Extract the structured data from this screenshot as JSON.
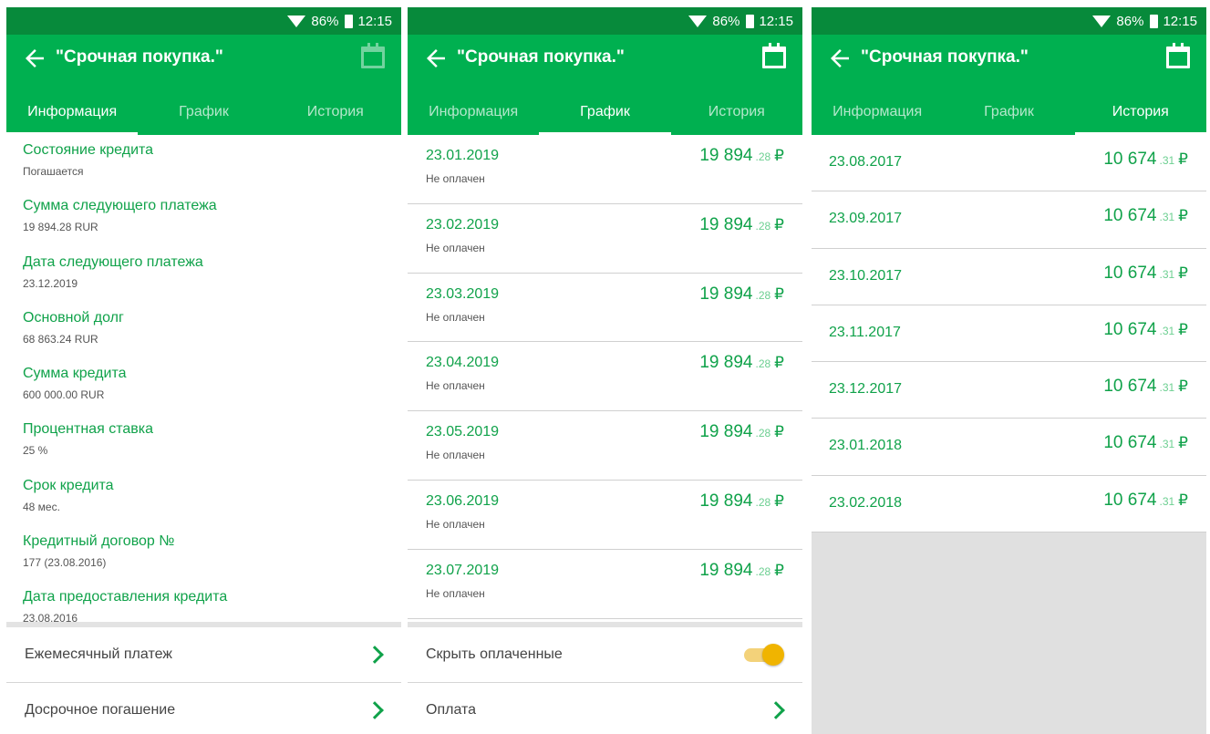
{
  "status": {
    "battery": "86%",
    "time": "12:15"
  },
  "title": "\"Срочная покупка.\"",
  "tabs": [
    "Информация",
    "График",
    "История"
  ],
  "currency_symbol": "₽",
  "info": {
    "items": [
      {
        "label": "Состояние кредита",
        "value": "Погашается"
      },
      {
        "label": "Сумма следующего платежа",
        "value": "19 894.28 RUR"
      },
      {
        "label": "Дата следующего платежа",
        "value": "23.12.2019"
      },
      {
        "label": "Основной долг",
        "value": "68 863.24 RUR"
      },
      {
        "label": "Сумма кредита",
        "value": "600 000.00 RUR"
      },
      {
        "label": "Процентная ставка",
        "value": "25 %"
      },
      {
        "label": "Срок кредита",
        "value": "48 мес."
      },
      {
        "label": "Кредитный договор №",
        "value": "177 (23.08.2016)"
      },
      {
        "label": "Дата предоставления кредита",
        "value": "23.08.2016"
      }
    ],
    "monthly_payment": "Ежемесячный платеж",
    "early_repayment": "Досрочное погашение"
  },
  "schedule": {
    "rows": [
      {
        "date": "23.01.2019",
        "status": "Не оплачен",
        "amount_main": "19 894",
        "amount_frac": ".28"
      },
      {
        "date": "23.02.2019",
        "status": "Не оплачен",
        "amount_main": "19 894",
        "amount_frac": ".28"
      },
      {
        "date": "23.03.2019",
        "status": "Не оплачен",
        "amount_main": "19 894",
        "amount_frac": ".28"
      },
      {
        "date": "23.04.2019",
        "status": "Не оплачен",
        "amount_main": "19 894",
        "amount_frac": ".28"
      },
      {
        "date": "23.05.2019",
        "status": "Не оплачен",
        "amount_main": "19 894",
        "amount_frac": ".28"
      },
      {
        "date": "23.06.2019",
        "status": "Не оплачен",
        "amount_main": "19 894",
        "amount_frac": ".28"
      },
      {
        "date": "23.07.2019",
        "status": "Не оплачен",
        "amount_main": "19 894",
        "amount_frac": ".28"
      }
    ],
    "hide_paid_label": "Скрыть оплаченные",
    "hide_paid_on": true,
    "payment_label": "Оплата"
  },
  "history": {
    "rows": [
      {
        "date": "23.08.2017",
        "amount_main": "10 674",
        "amount_frac": ".31"
      },
      {
        "date": "23.09.2017",
        "amount_main": "10 674",
        "amount_frac": ".31"
      },
      {
        "date": "23.10.2017",
        "amount_main": "10 674",
        "amount_frac": ".31"
      },
      {
        "date": "23.11.2017",
        "amount_main": "10 674",
        "amount_frac": ".31"
      },
      {
        "date": "23.12.2017",
        "amount_main": "10 674",
        "amount_frac": ".31"
      },
      {
        "date": "23.01.2018",
        "amount_main": "10 674",
        "amount_frac": ".31"
      },
      {
        "date": "23.02.2018",
        "amount_main": "10 674",
        "amount_frac": ".31"
      }
    ]
  },
  "colors": {
    "primary": "#00b050",
    "status_bar": "#078a3b",
    "accent_text": "#10a24a",
    "toggle": "#f0b400"
  }
}
